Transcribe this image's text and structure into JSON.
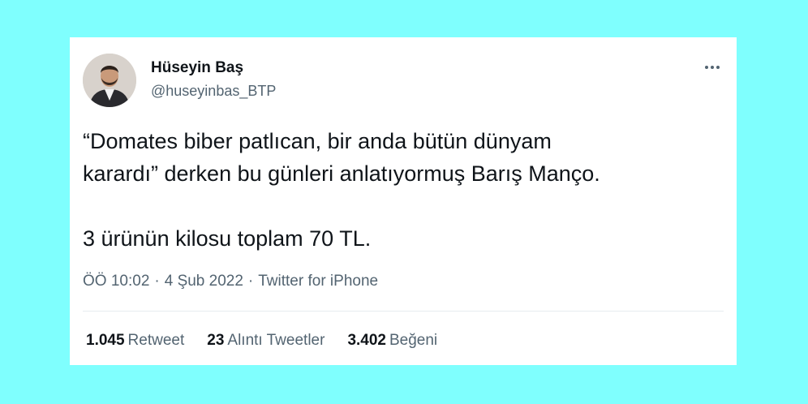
{
  "tweet": {
    "author": {
      "name": "Hüseyin Baş",
      "handle": "@huseyinbas_BTP"
    },
    "text_lines": [
      "“Domates biber patlıcan, bir anda bütün dünyam",
      "karardı” derken bu günleri anlatıyormuş Barış Manço.",
      "3 ürünün kilosu toplam 70 TL."
    ],
    "time": "ÖÖ 10:02",
    "date": "4 Şub 2022",
    "separator": "·",
    "source": "Twitter for iPhone",
    "stats": {
      "retweets_count": "1.045",
      "retweets_label": "Retweet",
      "quotes_count": "23",
      "quotes_label": "Alıntı Tweetler",
      "likes_count": "3.402",
      "likes_label": "Beğeni"
    }
  },
  "icons": {
    "more": "more-horizontal-icon"
  },
  "colors": {
    "background": "#7ffffe",
    "card": "#ffffff",
    "text_primary": "#0f1419",
    "text_secondary": "#536471"
  }
}
